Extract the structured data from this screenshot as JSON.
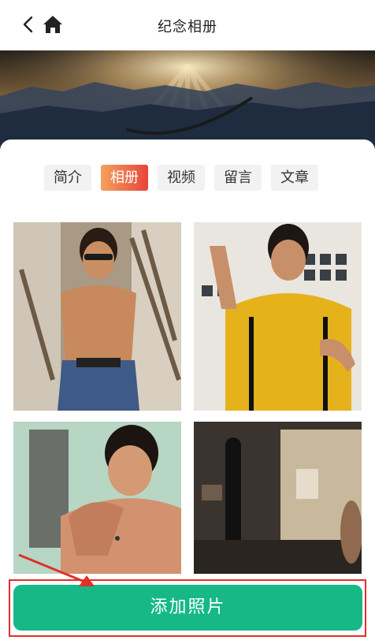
{
  "header": {
    "title": "纪念相册",
    "back_icon": "chevron-left-icon",
    "home_icon": "home-icon"
  },
  "tabs": [
    {
      "label": "简介",
      "active": false
    },
    {
      "label": "相册",
      "active": true
    },
    {
      "label": "视频",
      "active": false
    },
    {
      "label": "留言",
      "active": false
    },
    {
      "label": "文章",
      "active": false
    }
  ],
  "colors": {
    "accent_tab_start": "#f3a25e",
    "accent_tab_end": "#e8453b",
    "primary_button": "#16b986",
    "annotation_red": "#e0302a"
  },
  "photos": [
    {
      "description": "shirtless-man-with-sunglasses"
    },
    {
      "description": "man-in-yellow-jumpsuit"
    },
    {
      "description": "muscular-man-fighting-pose"
    },
    {
      "description": "gym-room-with-punching-bag"
    }
  ],
  "bottom": {
    "add_button_label": "添加照片"
  }
}
